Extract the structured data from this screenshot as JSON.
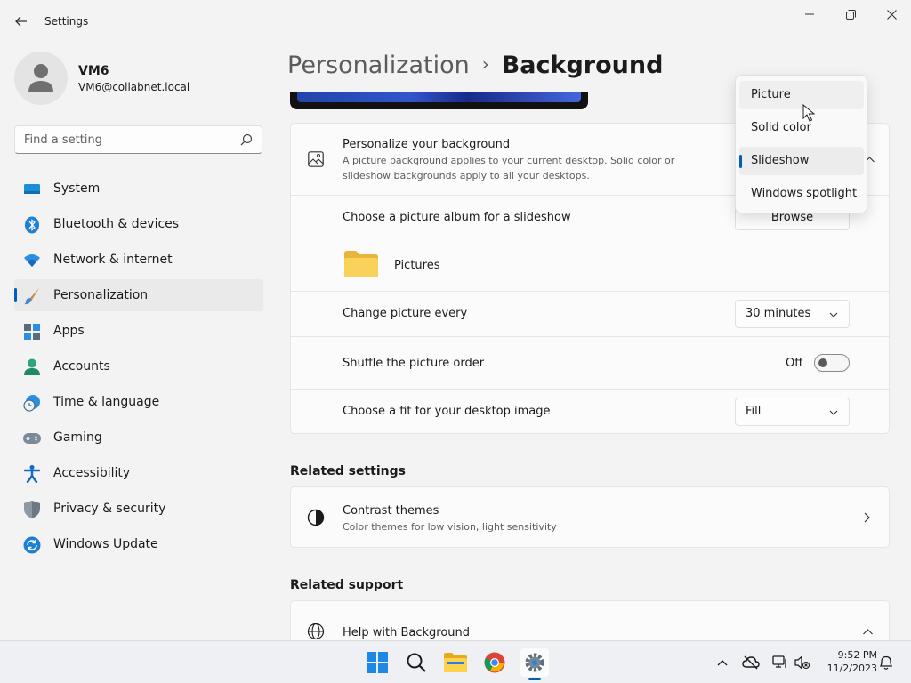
{
  "window": {
    "title": "Settings",
    "back_icon": "back-arrow-icon",
    "controls": [
      "minimize-icon",
      "maximize-icon",
      "close-icon"
    ]
  },
  "user": {
    "name": "VM6",
    "email": "VM6@collabnet.local"
  },
  "search": {
    "placeholder": "Find a setting",
    "value": ""
  },
  "sidebar": {
    "items": [
      {
        "label": "System",
        "icon": "system-icon",
        "active": false
      },
      {
        "label": "Bluetooth & devices",
        "icon": "bluetooth-icon",
        "active": false
      },
      {
        "label": "Network & internet",
        "icon": "wifi-icon",
        "active": false
      },
      {
        "label": "Personalization",
        "icon": "brush-icon",
        "active": true
      },
      {
        "label": "Apps",
        "icon": "apps-icon",
        "active": false
      },
      {
        "label": "Accounts",
        "icon": "accounts-icon",
        "active": false
      },
      {
        "label": "Time & language",
        "icon": "time-language-icon",
        "active": false
      },
      {
        "label": "Gaming",
        "icon": "gamepad-icon",
        "active": false
      },
      {
        "label": "Accessibility",
        "icon": "accessibility-icon",
        "active": false
      },
      {
        "label": "Privacy & security",
        "icon": "shield-icon",
        "active": false
      },
      {
        "label": "Windows Update",
        "icon": "update-icon",
        "active": false
      }
    ],
    "accent": "#005fb8"
  },
  "breadcrumb": {
    "parent": "Personalization",
    "separator": "›",
    "current": "Background"
  },
  "background_settings": {
    "personalize": {
      "title": "Personalize your background",
      "description": "A picture background applies to your current desktop. Solid color or slideshow backgrounds apply to all your desktops."
    },
    "album": {
      "title": "Choose a picture album for a slideshow",
      "button": "Browse",
      "folder": "Pictures"
    },
    "interval": {
      "title": "Change picture every",
      "value": "30 minutes"
    },
    "shuffle": {
      "title": "Shuffle the picture order",
      "state_label": "Off",
      "on": false
    },
    "fit": {
      "title": "Choose a fit for your desktop image",
      "value": "Fill"
    }
  },
  "dropdown": {
    "options": [
      "Picture",
      "Solid color",
      "Slideshow",
      "Windows spotlight"
    ],
    "selected": "Slideshow",
    "hovered": "Picture"
  },
  "related_settings": {
    "heading": "Related settings",
    "items": [
      {
        "title": "Contrast themes",
        "subtitle": "Color themes for low vision, light sensitivity"
      }
    ]
  },
  "related_support": {
    "heading": "Related support",
    "items": [
      {
        "title": "Help with Background"
      }
    ]
  },
  "taskbar": {
    "apps": [
      "start-icon",
      "search-icon",
      "file-explorer-icon",
      "chrome-icon",
      "settings-icon"
    ],
    "active_app": "settings-icon",
    "tray": [
      "chevron-up-icon",
      "cloud-off-icon",
      "network-icon",
      "volume-muted-icon",
      "notification-bell-icon"
    ],
    "time": "9:52 PM",
    "date": "11/2/2023"
  }
}
